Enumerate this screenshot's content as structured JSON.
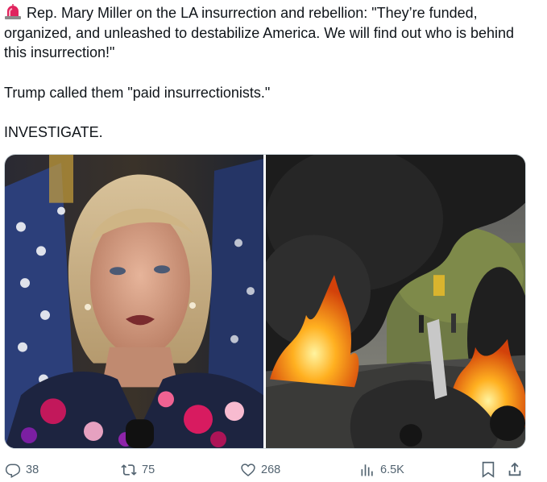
{
  "post": {
    "emoji_icon": "rotating-light-icon",
    "line1": "Rep. Mary Miller on the LA insurrection and rebellion: \"They’re funded, organized, and unleashed to destabilize America. We will find out who is behind this insurrection!\"",
    "line2": "Trump called them \"paid insurrectionists.\"",
    "line3": "INVESTIGATE."
  },
  "media": {
    "left_photo": "woman-speaking-at-podium-photo",
    "right_photo": "burning-vehicle-street-photo"
  },
  "actions": {
    "replies": "38",
    "reposts": "75",
    "likes": "268",
    "views": "6.5K"
  },
  "colors": {
    "text": "#0f1419",
    "muted": "#536471",
    "border": "#cfd9de"
  }
}
